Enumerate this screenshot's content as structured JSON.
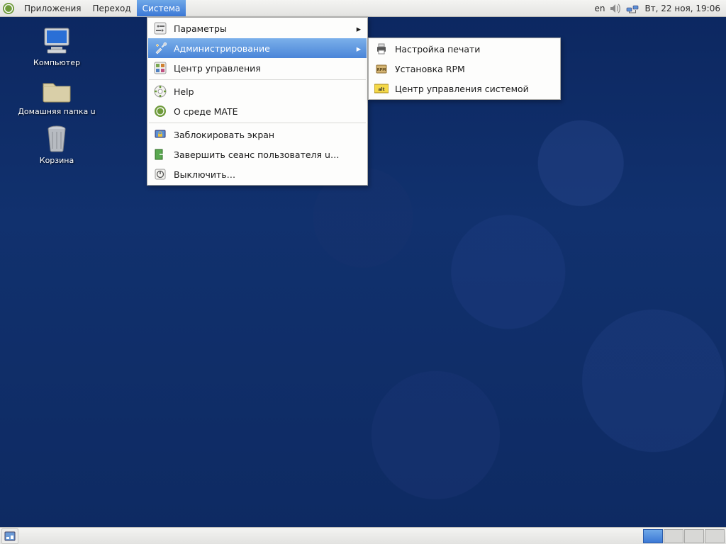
{
  "panel": {
    "menus": {
      "apps": "Приложения",
      "places": "Переход",
      "system": "Система"
    },
    "tray": {
      "lang": "en",
      "clock": "Вт, 22 ноя, 19:06"
    }
  },
  "desktop": {
    "icons": [
      {
        "name": "computer",
        "label": "Компьютер"
      },
      {
        "name": "home",
        "label": "Домашняя папка u"
      },
      {
        "name": "trash",
        "label": "Корзина"
      }
    ]
  },
  "system_menu": {
    "items": [
      {
        "id": "preferences",
        "label": "Параметры",
        "icon": "sliders",
        "submenu": true
      },
      {
        "id": "administration",
        "label": "Администрирование",
        "icon": "tools",
        "submenu": true,
        "highlighted": true
      },
      {
        "id": "control-center",
        "label": "Центр управления",
        "icon": "control-center"
      },
      {
        "sep": true
      },
      {
        "id": "help",
        "label": "Help",
        "icon": "help"
      },
      {
        "id": "about-mate",
        "label": "О среде MATE",
        "icon": "mate-logo"
      },
      {
        "sep": true
      },
      {
        "id": "lock",
        "label": "Заблокировать экран",
        "icon": "lock"
      },
      {
        "id": "logout",
        "label": "Завершить сеанс пользователя u…",
        "icon": "logout"
      },
      {
        "id": "shutdown",
        "label": "Выключить…",
        "icon": "shutdown"
      }
    ]
  },
  "admin_submenu": {
    "items": [
      {
        "id": "print-setup",
        "label": "Настройка печати",
        "icon": "printer"
      },
      {
        "id": "rpm-install",
        "label": "Установка RPM",
        "icon": "rpm"
      },
      {
        "id": "sys-control-center",
        "label": "Центр управления системой",
        "icon": "alt"
      }
    ]
  },
  "bottom": {
    "workspaces": 4,
    "active": 0
  }
}
